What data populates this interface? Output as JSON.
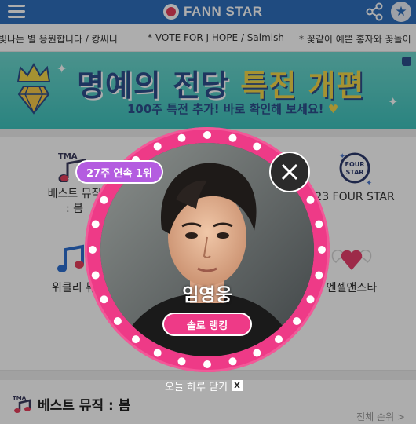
{
  "header": {
    "app_name": "FANN STAR",
    "icons": [
      "hamburger-menu-icon",
      "fannstar-logo-icon",
      "share-icon",
      "star-icon"
    ],
    "colors": {
      "header_bg": "#2f6fbd",
      "accent_pink": "#ee3a87",
      "badge_purple": "#b45ce0"
    }
  },
  "ticker": {
    "items": [
      "빛나는 별 응원합니다 / 캉써니",
      "* VOTE FOR J HOPE / Salmish",
      "* 꽃같이 예쁜 홍자와 꽃놀이"
    ]
  },
  "banner": {
    "title_part1": "명예의 전당",
    "title_part2": "특전 개편",
    "subtitle": "100주 특전 추가! 바로 확인해 보세요!",
    "heart": "♥"
  },
  "grid": {
    "cells": [
      {
        "label_line1": "베스트 뮤직",
        "label_line2": ": 봄",
        "icon": "tma-music-note-icon"
      },
      {
        "label_line1": "23 FOUR STAR",
        "label_line2": "",
        "icon": "four-star-badge-icon"
      },
      {
        "label_line1": "위클리 뮤",
        "label_line2": "",
        "icon": "weekly-music-note-icon"
      },
      {
        "label_line1": "엔젤앤스타",
        "label_line2": "",
        "icon": "winged-heart-icon"
      }
    ]
  },
  "section": {
    "title": "베스트 뮤직 : 봄",
    "link": "전체 순위 >",
    "icon": "tma-music-note-icon"
  },
  "popup": {
    "rank_badge": "27주 연속 1위",
    "artist_name": "임영웅",
    "solo_button": "솔로 랭킹",
    "dismiss_text": "오늘 하루 닫기",
    "dismiss_x": "X"
  }
}
